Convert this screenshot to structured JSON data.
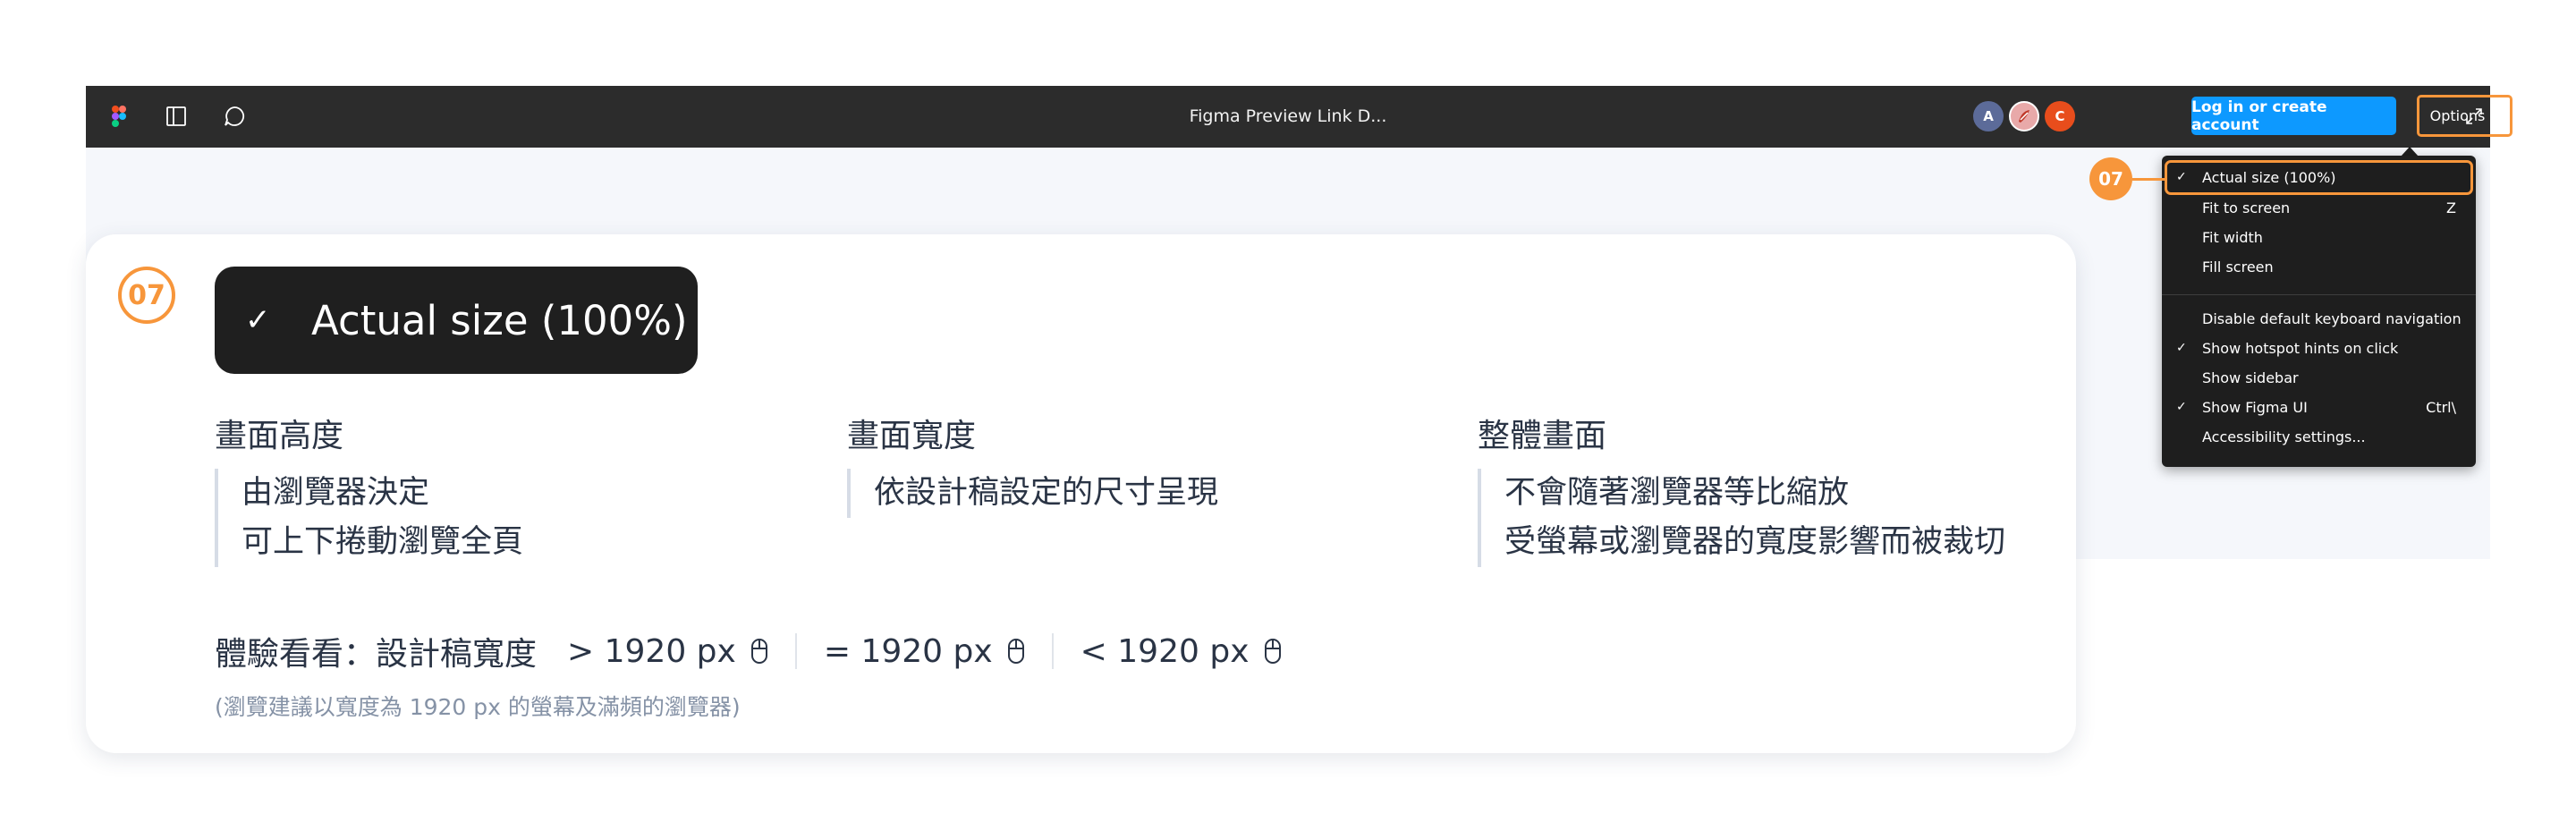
{
  "topbar": {
    "title": "Figma Preview Link D...",
    "icons": [
      "figma-logo-icon",
      "sidebar-panel-icon",
      "comment-icon"
    ],
    "avatars": [
      {
        "initial": "A",
        "color": "#5c6b99"
      },
      {
        "initial": "",
        "color": "#e8a9a9"
      },
      {
        "initial": "C",
        "color": "#e84d1c"
      }
    ],
    "login_label": "Log in or create account",
    "options_label": "Options",
    "expand_icon": "expand-icon"
  },
  "menu": {
    "badge": "07",
    "items": [
      {
        "label": "Actual size (100%)",
        "checked": true,
        "shortcut": "",
        "highlighted": true
      },
      {
        "label": "Fit to screen",
        "checked": false,
        "shortcut": "Z"
      },
      {
        "label": "Fit width",
        "checked": false,
        "shortcut": ""
      },
      {
        "label": "Fill screen",
        "checked": false,
        "shortcut": ""
      },
      {
        "label": "Disable default keyboard navigation",
        "checked": false,
        "shortcut": ""
      },
      {
        "label": "Show hotspot hints on click",
        "checked": true,
        "shortcut": ""
      },
      {
        "label": "Show sidebar",
        "checked": false,
        "shortcut": ""
      },
      {
        "label": "Show Figma UI",
        "checked": true,
        "shortcut": "Ctrl\\"
      },
      {
        "label": "Accessibility settings...",
        "checked": false,
        "shortcut": ""
      }
    ]
  },
  "card": {
    "badge": "07",
    "check": "✓",
    "title": "Actual size (100%)",
    "columns": [
      {
        "heading": "畫面高度",
        "lines": [
          "由瀏覽器決定",
          "可上下捲動瀏覽全頁"
        ]
      },
      {
        "heading": "畫面寬度",
        "lines": [
          "依設計稿設定的尺寸呈現"
        ]
      },
      {
        "heading": "整體畫面",
        "lines": [
          "不會隨著瀏覽器等比縮放",
          "受螢幕或瀏覽器的寬度影響而被裁切"
        ]
      }
    ],
    "try_label": "體驗看看：設計稿寬度",
    "try_options": [
      "> 1920 px",
      "= 1920 px",
      "< 1920 px"
    ],
    "note": "(瀏覽建議以寬度為 1920 px 的螢幕及滿頻的瀏覽器)"
  },
  "colors": {
    "accent": "#f7963b",
    "topbar": "#2c2c2c",
    "login": "#0d99ff",
    "menu_bg": "#1e1e1e"
  }
}
